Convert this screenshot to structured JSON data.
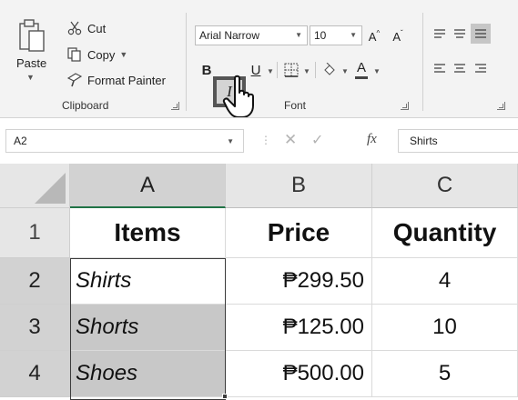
{
  "clipboard": {
    "paste_label": "Paste",
    "cut_label": "Cut",
    "copy_label": "Copy",
    "format_painter_label": "Format Painter",
    "group_label": "Clipboard"
  },
  "font": {
    "family": "Arial Narrow",
    "size": "10",
    "grow_label": "A",
    "shrink_label": "A",
    "bold_label": "B",
    "italic_label": "I",
    "underline_label": "U",
    "font_color_label": "A",
    "group_label": "Font"
  },
  "formula_bar": {
    "name_box": "A2",
    "fx_label": "fx",
    "content": "Shirts"
  },
  "grid": {
    "columns": [
      "A",
      "B",
      "C"
    ],
    "rows": [
      "1",
      "2",
      "3",
      "4"
    ],
    "headers": [
      "Items",
      "Price",
      "Quantity"
    ],
    "data": [
      [
        "Shirts",
        "₱299.50",
        "4"
      ],
      [
        "Shorts",
        "₱125.00",
        "10"
      ],
      [
        "Shoes",
        "₱500.00",
        "5"
      ]
    ]
  },
  "colors": {
    "ribbon_bg": "#f3f3f3",
    "header_bg": "#e6e6e6",
    "selection_shade": "#c8c8c8",
    "active_column_border": "#217346"
  }
}
